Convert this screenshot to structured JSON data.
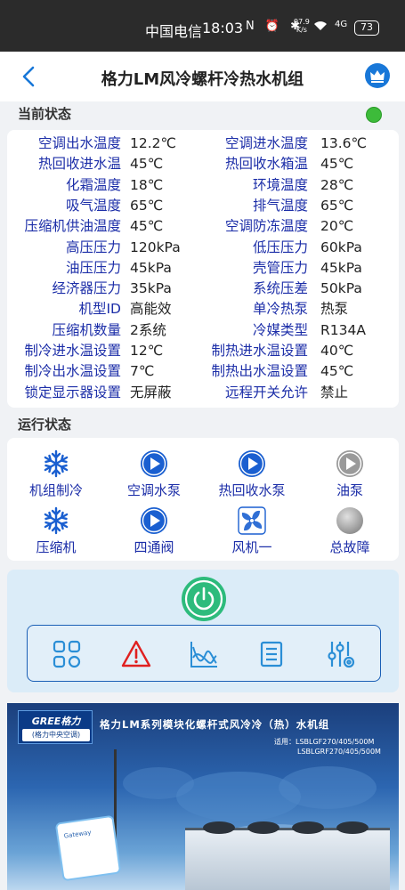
{
  "status_bar": {
    "carrier": "中国电信",
    "time": "18:03",
    "icons": "N ⏰ ✱",
    "speed_value": "97.9",
    "speed_unit": "K/s",
    "network": "4G",
    "battery": "73"
  },
  "header": {
    "title": "格力LM风冷螺杆冷热水机组",
    "back_icon": "chevron-left-icon",
    "right_icon": "crown-icon",
    "accent_color": "#1877d8"
  },
  "current_status": {
    "heading": "当前状态",
    "indicator_color": "#3dbb3a",
    "rows": [
      {
        "l_label": "空调出水温度",
        "l_value": "12.2℃",
        "r_label": "空调进水温度",
        "r_value": "13.6℃"
      },
      {
        "l_label": "热回收进水温",
        "l_value": "45℃",
        "r_label": "热回收水箱温",
        "r_value": "45℃"
      },
      {
        "l_label": "化霜温度",
        "l_value": "18℃",
        "r_label": "环境温度",
        "r_value": "28℃"
      },
      {
        "l_label": "吸气温度",
        "l_value": "65℃",
        "r_label": "排气温度",
        "r_value": "65℃"
      },
      {
        "l_label": "压缩机供油温度",
        "l_value": "45℃",
        "r_label": "空调防冻温度",
        "r_value": "20℃"
      },
      {
        "l_label": "高压压力",
        "l_value": "120kPa",
        "r_label": "低压压力",
        "r_value": "60kPa"
      },
      {
        "l_label": "油压压力",
        "l_value": "45kPa",
        "r_label": "壳管压力",
        "r_value": "45kPa"
      },
      {
        "l_label": "经济器压力",
        "l_value": "35kPa",
        "r_label": "系统压差",
        "r_value": "50kPa"
      },
      {
        "l_label": "机型ID",
        "l_value": "高能效",
        "r_label": "单冷热泵",
        "r_value": "热泵"
      },
      {
        "l_label": "压缩机数量",
        "l_value": "2系统",
        "r_label": "冷媒类型",
        "r_value": "R134A"
      },
      {
        "l_label": "制冷进水温设置",
        "l_value": "12℃",
        "r_label": "制热进水温设置",
        "r_value": "40℃"
      },
      {
        "l_label": "制冷出水温设置",
        "l_value": "7℃",
        "r_label": "制热出水温设置",
        "r_value": "45℃"
      },
      {
        "l_label": "锁定显示器设置",
        "l_value": "无屏蔽",
        "r_label": "远程开关允许",
        "r_value": "禁止"
      }
    ]
  },
  "run_status": {
    "heading": "运行状态",
    "items": [
      {
        "label": "机组制冷",
        "icon": "snowflake-icon",
        "state": "active"
      },
      {
        "label": "空调水泵",
        "icon": "play-icon",
        "state": "active"
      },
      {
        "label": "热回收水泵",
        "icon": "play-icon",
        "state": "active"
      },
      {
        "label": "油泵",
        "icon": "play-icon",
        "state": "inactive"
      },
      {
        "label": "压缩机",
        "icon": "snowflake-icon",
        "state": "active"
      },
      {
        "label": "四通阀",
        "icon": "play-icon",
        "state": "active"
      },
      {
        "label": "风机一",
        "icon": "fan-icon",
        "state": "active"
      },
      {
        "label": "总故障",
        "icon": "fault-dot-icon",
        "state": "inactive"
      }
    ],
    "active_color": "#1a5fd0",
    "inactive_color": "#9a9a9a"
  },
  "controls": {
    "power_icon": "power-icon",
    "power_color": "#2dbb7c",
    "tools": [
      {
        "name": "grid-icon"
      },
      {
        "name": "warning-icon"
      },
      {
        "name": "chart-icon"
      },
      {
        "name": "list-icon"
      },
      {
        "name": "sliders-icon"
      }
    ]
  },
  "banner": {
    "logo_text": "GREE格力",
    "logo_sub": "(格力中央空调)",
    "title": "格力LM系列模块化螺杆式风冷冷（热）水机组",
    "models_prefix": "适用：LSBLGF270/405/500M",
    "models_line2": "LSBLGRF270/405/500M",
    "device_text": "Gateway"
  }
}
